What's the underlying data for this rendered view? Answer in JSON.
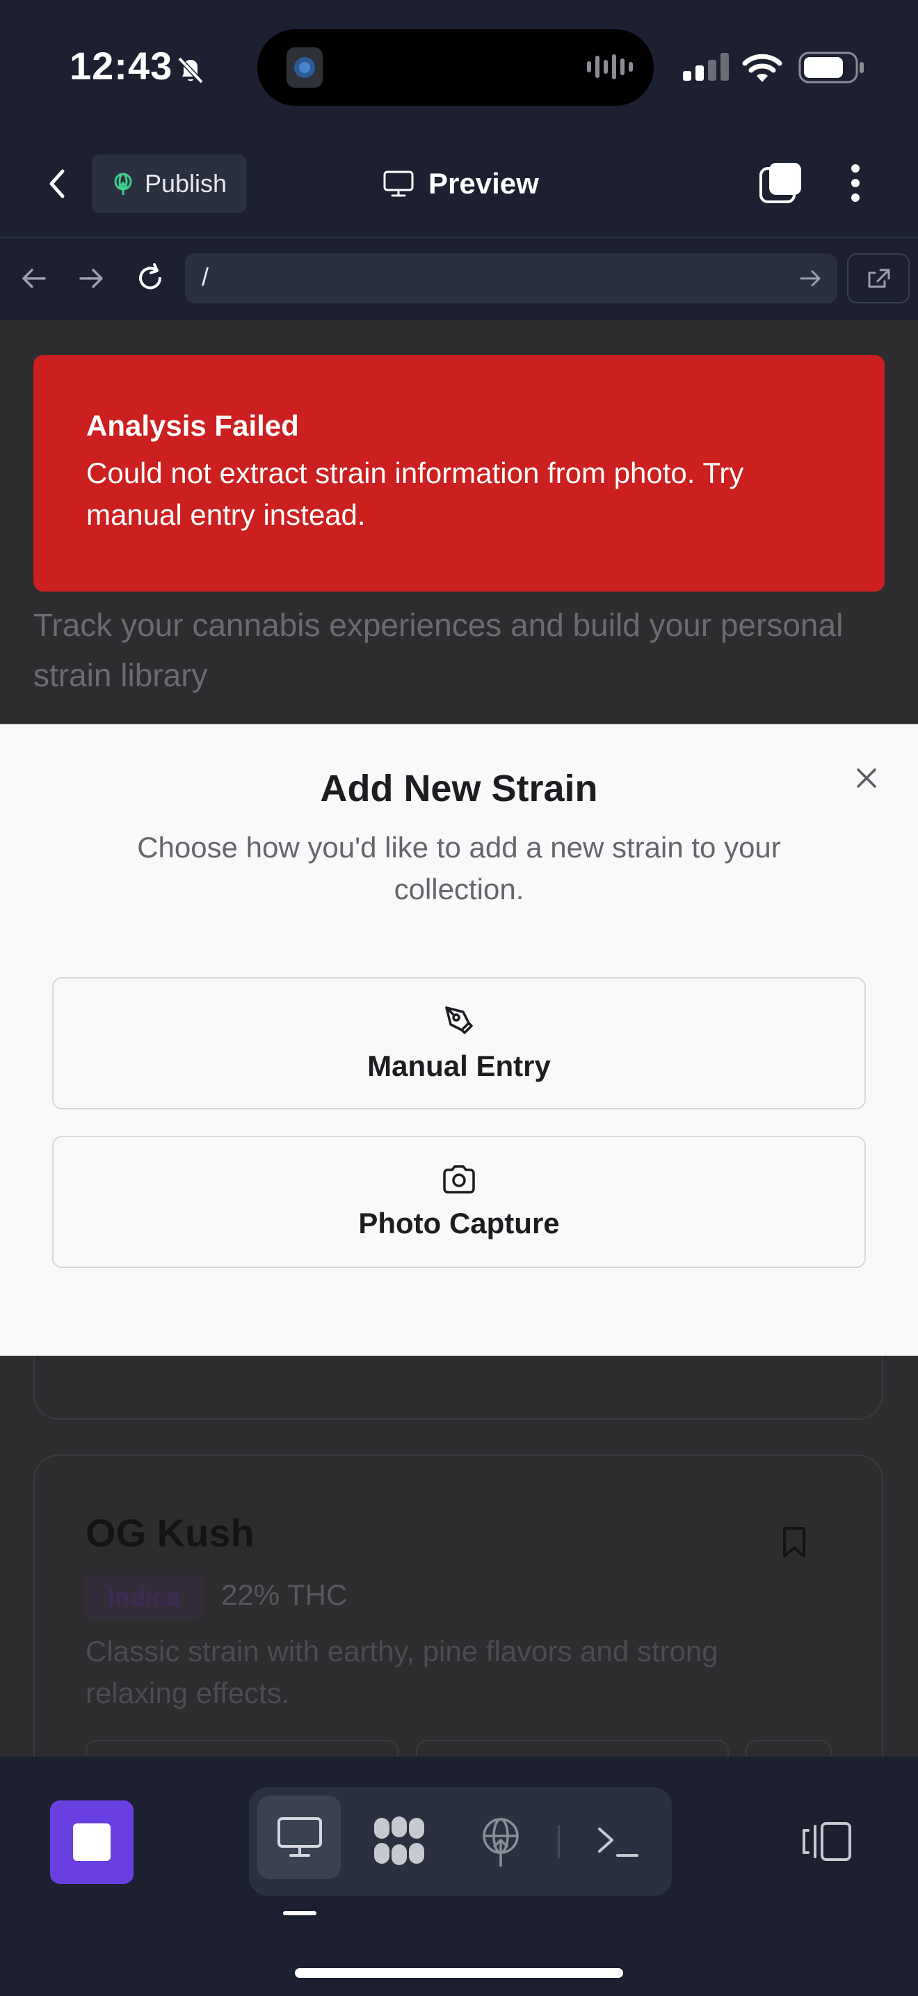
{
  "status_bar": {
    "time": "12:43"
  },
  "header": {
    "publish_label": "Publish",
    "preview_label": "Preview"
  },
  "browser": {
    "url": "/"
  },
  "page": {
    "subtitle": "Track your cannabis experiences and build your personal strain library",
    "strain": {
      "name": "OG Kush",
      "type": "Indica",
      "thc": "22% THC",
      "description": "Classic strain with earthy, pine flavors and strong relaxing effects."
    }
  },
  "toast": {
    "title": "Analysis Failed",
    "message": "Could not extract strain information from photo. Try manual entry instead."
  },
  "modal": {
    "title": "Add New Strain",
    "description": "Choose how you'd like to add a new strain to your collection.",
    "options": [
      {
        "label": "Manual Entry",
        "icon": "pen-tool-icon"
      },
      {
        "label": "Photo Capture",
        "icon": "camera-icon"
      }
    ]
  },
  "colors": {
    "accent": "#6a3fe0",
    "toast_bg": "#cc1f1f",
    "publish_icon": "#3ecf8e"
  }
}
